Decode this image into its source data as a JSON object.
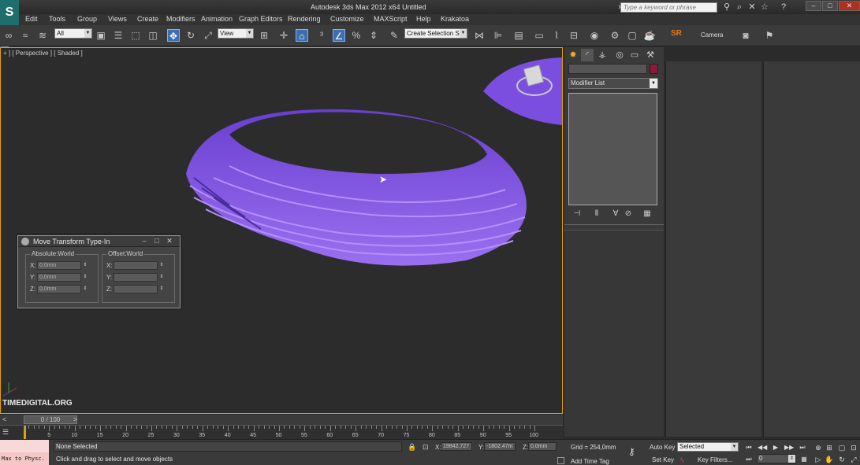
{
  "titlebar": {
    "app_title": "Autodesk 3ds Max  2012 x64        Untitled",
    "search_placeholder": "Type a keyword or phrase"
  },
  "menubar": {
    "items": [
      "Edit",
      "Tools",
      "Group",
      "Views",
      "Create",
      "Modifiers",
      "Animation",
      "Graph Editors",
      "Rendering",
      "Customize",
      "MAXScript",
      "Help",
      "Krakatoa"
    ]
  },
  "toolbar": {
    "selection_filter": "All",
    "ref_coord": "View",
    "named_selection": "Create Selection Se",
    "sr_label": "SR",
    "camera_label": "Camera"
  },
  "viewport": {
    "label": "+ ] [ Perspective ] [ Shaded ]",
    "watermark": "TIMEDIGITAL.ORG",
    "object_color": "#8a5ae8"
  },
  "dialog": {
    "title": "Move Transform Type-In",
    "absolute": {
      "title": "Absolute:World",
      "x": "0,0mm",
      "y": "0,0mm",
      "z": "0,0mm"
    },
    "offset": {
      "title": "Offset:World",
      "x": "",
      "y": "",
      "z": ""
    }
  },
  "command_panel": {
    "modifier_list": "Modifier List"
  },
  "timeline": {
    "slider": "0 / 100",
    "ticks": [
      "5",
      "10",
      "15",
      "20",
      "25",
      "30",
      "35",
      "40",
      "45",
      "50",
      "55",
      "60",
      "65",
      "70",
      "75",
      "80",
      "85",
      "90",
      "95",
      "100"
    ]
  },
  "statusbar": {
    "maxscript": "Max to Physc.",
    "selection": "None Selected",
    "prompt": "Click and drag to select and move objects",
    "x_label": "X:",
    "x_value": "19842,727",
    "y_label": "Y:",
    "y_value": "-1802,47m",
    "z_label": "Z:",
    "z_value": "0,0mm",
    "grid": "Grid = 254,0mm",
    "add_time_tag": "Add Time Tag",
    "auto_key": "Auto Key",
    "set_key": "Set Key",
    "key_mode": "Selected",
    "key_filters": "Key Filters...",
    "frame": "0"
  }
}
